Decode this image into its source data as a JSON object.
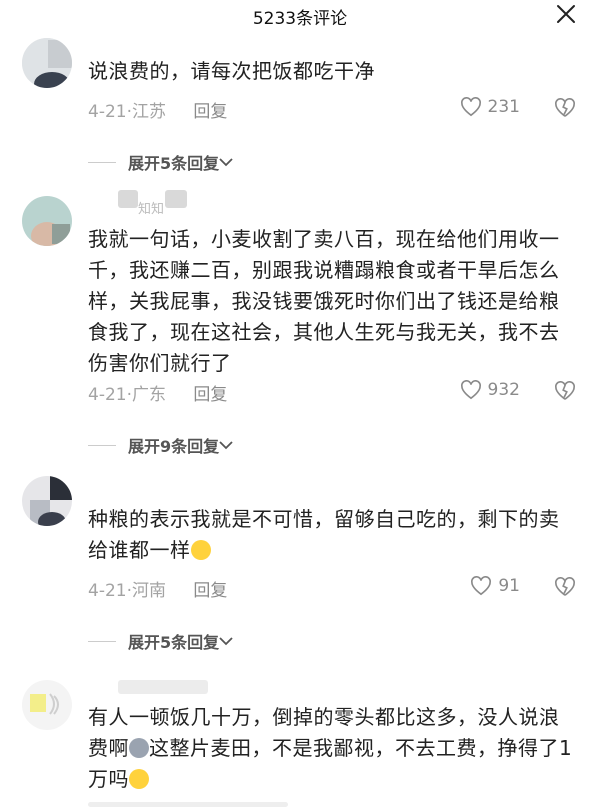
{
  "header": {
    "title": "5233条评论"
  },
  "comments": [
    {
      "text": "说浪费的，请每次把饭都吃干净",
      "date": "4-21",
      "region": "江苏",
      "reply_label": "回复",
      "likes": "231",
      "expand_label": "展开5条回复"
    },
    {
      "username": "知知",
      "text": "我就一句话，小麦收割了卖八百，现在给他们用收一千，我还赚二百，别跟我说糟蹋粮食或者干旱后怎么样，关我屁事，我没钱要饿死时你们出了钱还是给粮食我了，现在这社会，其他人生死与我无关，我不去伤害你们就行了",
      "date": "4-21",
      "region": "广东",
      "reply_label": "回复",
      "likes": "932",
      "expand_label": "展开9条回复"
    },
    {
      "text": "种粮的表示我就是不可惜，留够自己吃的，剩下的卖给谁都一样",
      "date": "4-21",
      "region": "河南",
      "reply_label": "回复",
      "likes": "91",
      "expand_label": "展开5条回复"
    },
    {
      "text_a": "有人一顿饭几十万，倒掉的零头都比这多，没人说浪费啊",
      "text_b": "这整片麦田，不是我鄙视，不去工费，挣得了1万吗"
    }
  ],
  "icons": {
    "close": "close-icon",
    "like": "heart-icon",
    "dislike": "broken-heart-icon",
    "expand": "chevron-down-icon"
  },
  "colors": {
    "meta": "#a3a3a3",
    "text": "#222222"
  }
}
